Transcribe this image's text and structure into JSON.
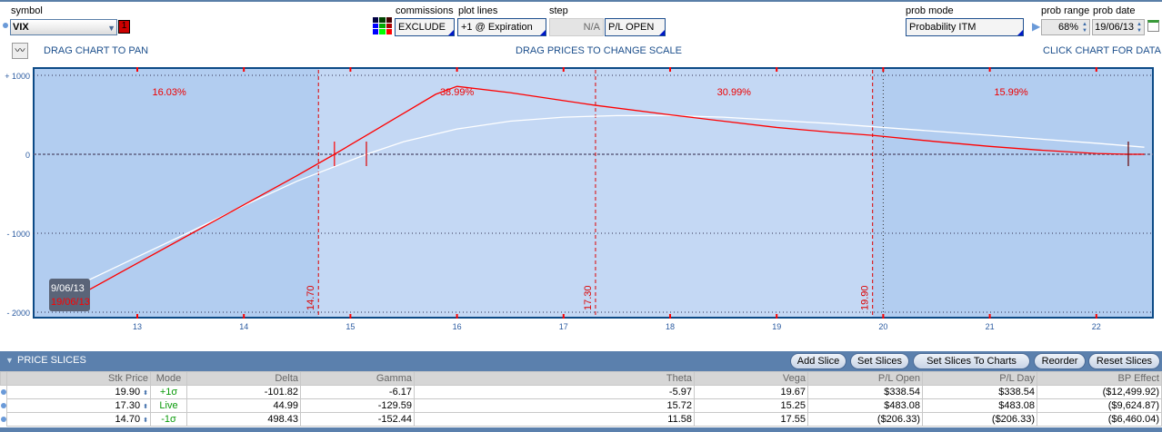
{
  "header": {
    "symbol_label": "symbol",
    "symbol": "VIX",
    "symbol_badge": "1",
    "commissions_label": "commissions",
    "commissions": "EXCLUDE",
    "plot_lines_label": "plot lines",
    "plot_lines": "+1 @ Expiration",
    "step_label": "step",
    "step": "N/A",
    "pl_mode": "P/L OPEN",
    "prob_mode_label": "prob mode",
    "prob_mode": "Probability ITM",
    "prob_range_label": "prob range",
    "prob_range": "68%",
    "prob_date_label": "prob date",
    "prob_date": "19/06/13"
  },
  "hints": {
    "pan": "DRAG CHART TO PAN",
    "scale": "DRAG PRICES TO CHANGE SCALE",
    "data": "CLICK CHART FOR DATA"
  },
  "chart_data": {
    "type": "line",
    "xlim": [
      12.3,
      22.8
    ],
    "ylim": [
      -2100,
      1100
    ],
    "y_ticks": [
      {
        "v": 1000,
        "label": "+ 1000"
      },
      {
        "v": 0,
        "label": "0"
      },
      {
        "v": -1000,
        "label": "- 1000"
      },
      {
        "v": -2000,
        "label": "- 2000"
      }
    ],
    "x_ticks": [
      "13",
      "14",
      "15",
      "16",
      "17",
      "18",
      "19",
      "20",
      "21",
      "22"
    ],
    "slices": [
      {
        "v": 14.7,
        "label": "14.70"
      },
      {
        "v": 17.3,
        "label": "17.30"
      },
      {
        "v": 19.9,
        "label": "19.90"
      }
    ],
    "probabilities": [
      {
        "x": 13.3,
        "label": "16.03%"
      },
      {
        "x": 16.0,
        "label": "38.99%"
      },
      {
        "x": 18.6,
        "label": "30.99%"
      },
      {
        "x": 21.2,
        "label": "15.99%"
      }
    ],
    "series": [
      {
        "name": "19/06/13",
        "color": "#ff0000",
        "x": [
          12.3,
          13,
          13.5,
          14,
          14.5,
          14.85,
          15.2,
          15.5,
          15.8,
          16.0,
          16.5,
          17,
          17.3,
          18,
          18.5,
          19,
          19.5,
          19.9,
          20.5,
          21,
          21.5,
          22,
          22.3,
          22.45
        ],
        "y": [
          -1900,
          -1380,
          -1010,
          -640,
          -270,
          0,
          280,
          520,
          760,
          860,
          780,
          680,
          620,
          500,
          420,
          340,
          280,
          240,
          160,
          100,
          50,
          10,
          0,
          0
        ]
      },
      {
        "name": "9/06/13",
        "color": "#ffffff",
        "x": [
          12.3,
          13,
          13.5,
          14,
          14.5,
          15.15,
          15.5,
          16,
          16.5,
          17,
          17.5,
          18,
          18.5,
          19,
          19.5,
          20,
          20.5,
          21,
          21.5,
          22,
          22.45
        ],
        "y": [
          -1750,
          -1300,
          -980,
          -650,
          -340,
          0,
          160,
          320,
          420,
          470,
          490,
          490,
          470,
          430,
          390,
          340,
          290,
          240,
          190,
          140,
          90
        ]
      }
    ],
    "breakevens": [
      14.85,
      15.15,
      22.3
    ],
    "legend": [
      "9/06/13",
      "19/06/13"
    ]
  },
  "slices_panel": {
    "title": "PRICE SLICES",
    "buttons": [
      "Add Slice",
      "Set Slices",
      "Set Slices To Charts",
      "Reorder",
      "Reset Slices"
    ],
    "columns": [
      "Stk Price",
      "Mode",
      "Delta",
      "Gamma",
      "Theta",
      "Vega",
      "P/L Open",
      "P/L Day",
      "BP Effect"
    ],
    "rows": [
      [
        "19.90",
        "+1σ",
        "-101.82",
        "-6.17",
        "-5.97",
        "19.67",
        "$338.54",
        "$338.54",
        "($12,499.92)"
      ],
      [
        "17.30",
        "Live",
        "44.99",
        "-129.59",
        "15.72",
        "15.25",
        "$483.08",
        "$483.08",
        "($9,624.87)"
      ],
      [
        "14.70",
        "-1σ",
        "498.43",
        "-152.44",
        "11.58",
        "17.55",
        "($206.33)",
        "($206.33)",
        "($6,460.04)"
      ]
    ]
  }
}
